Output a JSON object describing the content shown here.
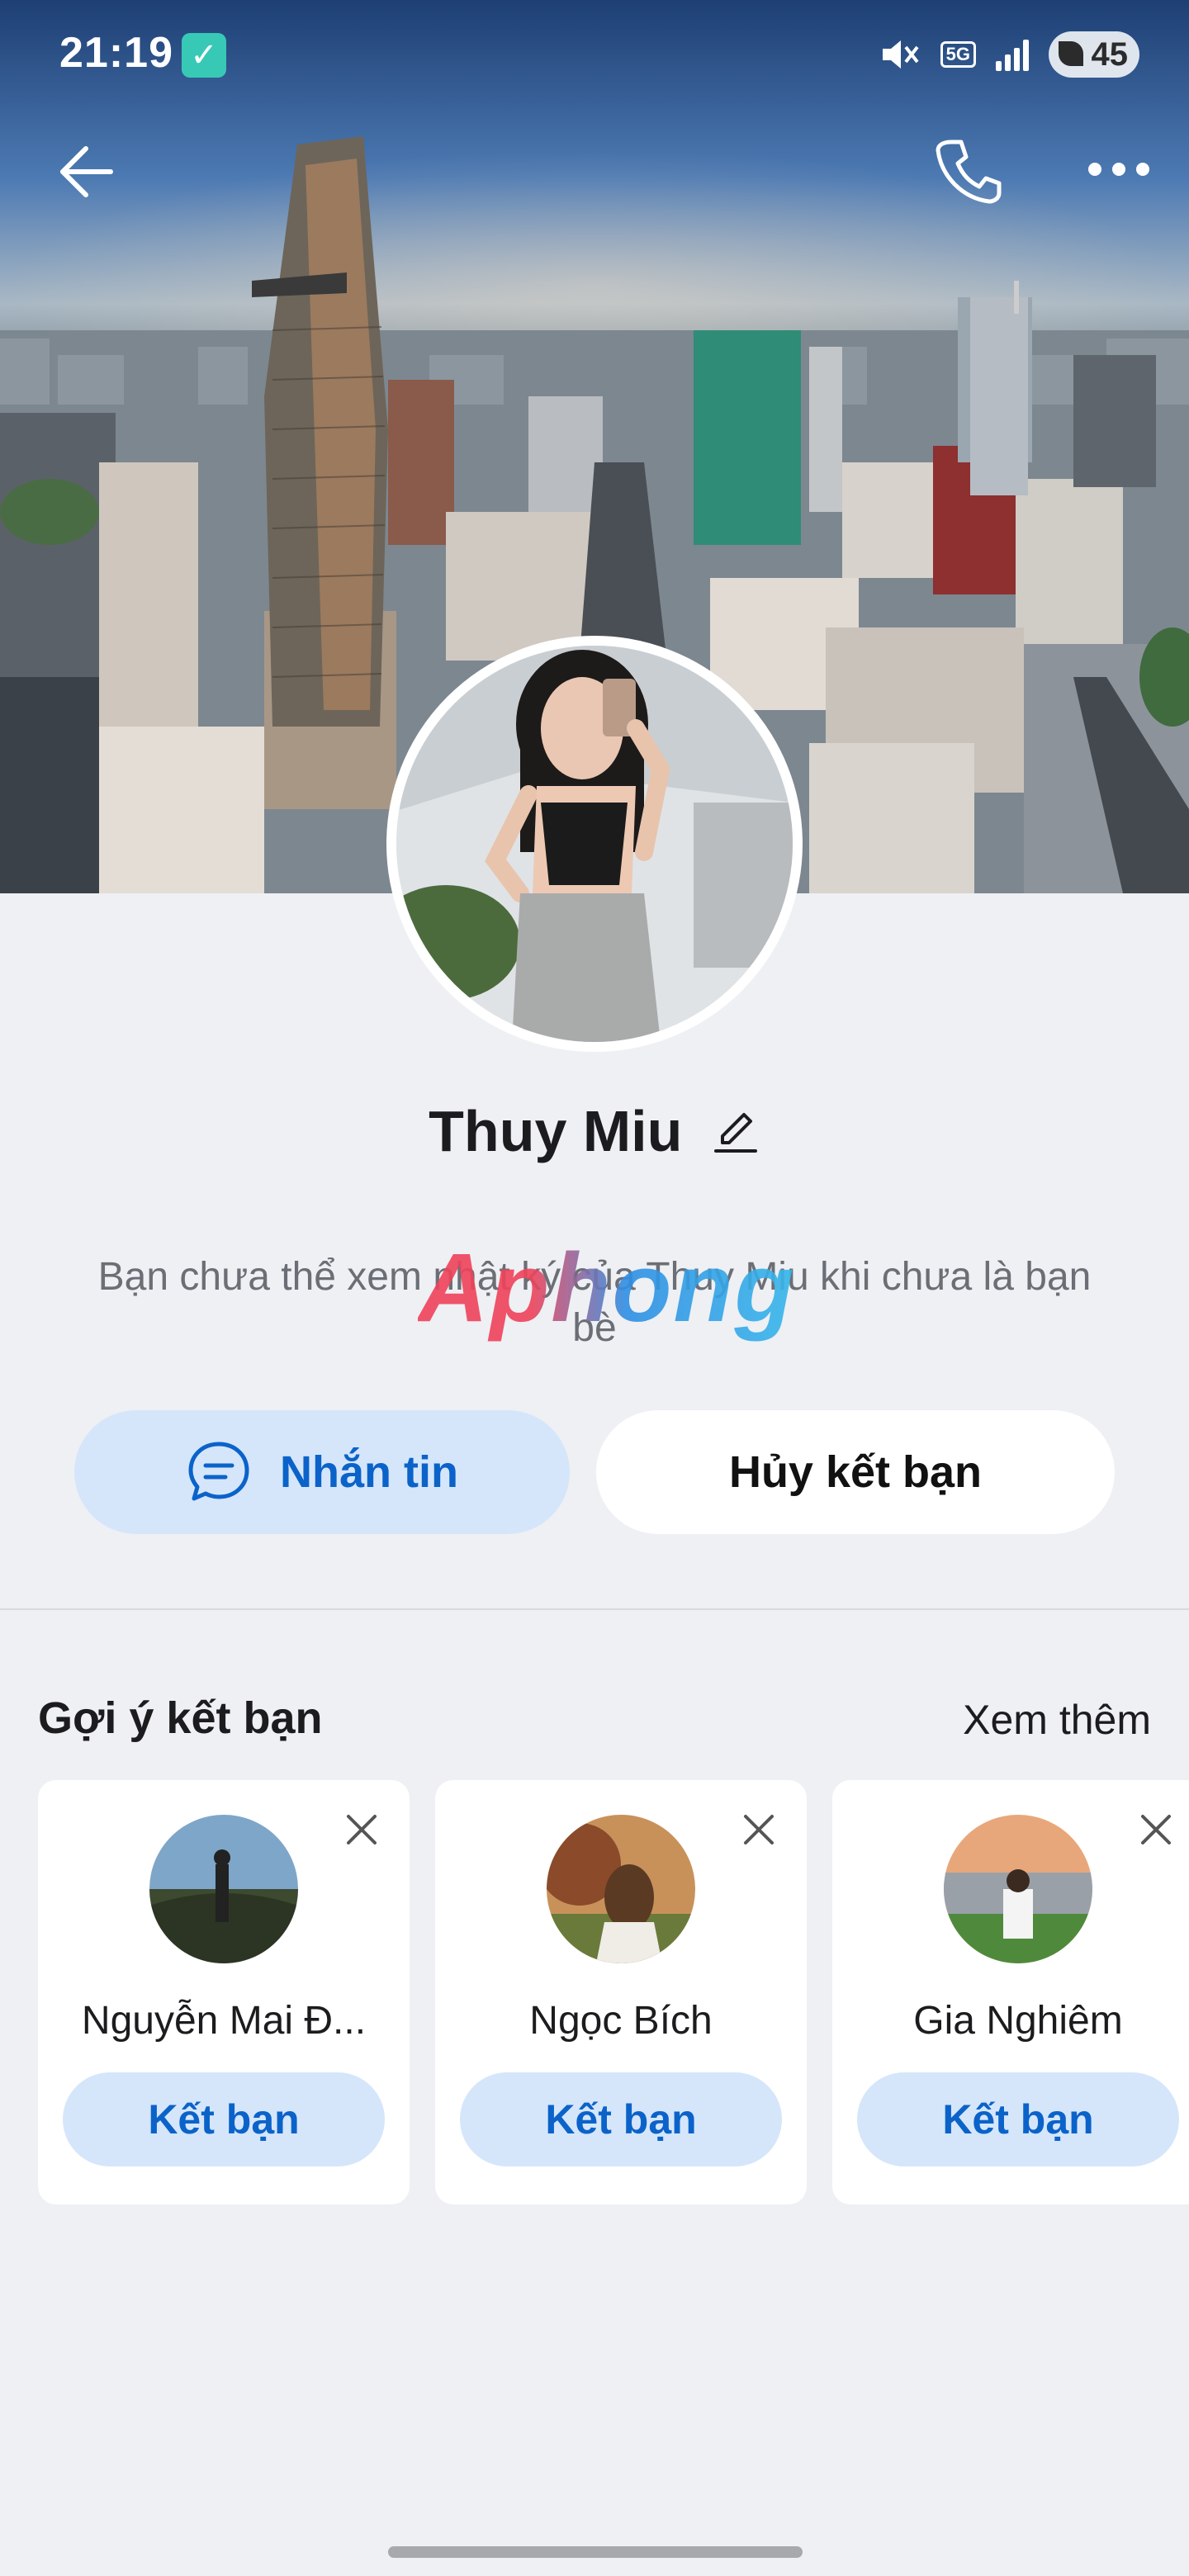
{
  "status_bar": {
    "time": "21:19",
    "network": "5G",
    "battery": "45"
  },
  "profile": {
    "name": "Thuy Miu",
    "notice": "Bạn chưa thể xem nhật ký của Thuy Miu khi chưa là bạn bè",
    "watermark": "Aphong"
  },
  "actions": {
    "message_label": "Nhắn tin",
    "unfriend_label": "Hủy kết bạn"
  },
  "suggestions": {
    "title": "Gợi ý kết bạn",
    "see_more": "Xem thêm",
    "items": [
      {
        "name": "Nguyễn Mai Đ...",
        "add_label": "Kết bạn"
      },
      {
        "name": "Ngọc Bích",
        "add_label": "Kết bạn"
      },
      {
        "name": "Gia Nghiêm",
        "add_label": "Kết bạn"
      }
    ]
  },
  "colors": {
    "accent": "#0b63c9",
    "accent_light": "#d5e6fb",
    "background": "#eef0f4"
  }
}
